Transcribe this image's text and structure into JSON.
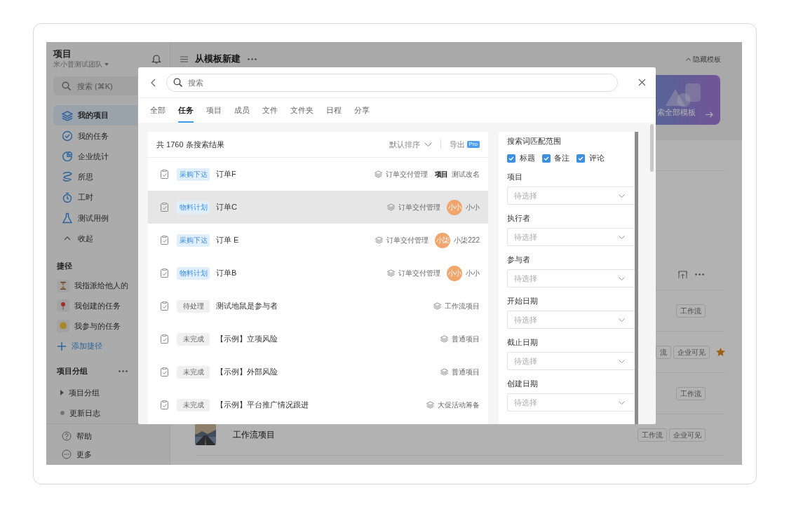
{
  "sidebar": {
    "title": "项目",
    "team": "米小普测试团队",
    "search_placeholder": "搜索 (⌘K)",
    "nav": [
      {
        "label": "我的项目",
        "selected": true
      },
      {
        "label": "我的任务",
        "selected": false
      },
      {
        "label": "企业统计",
        "selected": false
      },
      {
        "label": "所思",
        "selected": false
      },
      {
        "label": "工时",
        "selected": false
      },
      {
        "label": "测试用例",
        "selected": false
      },
      {
        "label": "收起",
        "selected": false
      }
    ],
    "shortcuts_title": "捷径",
    "shortcuts": [
      {
        "label": "我指派给他人的"
      },
      {
        "label": "我创建的任务"
      },
      {
        "label": "我参与的任务"
      }
    ],
    "add_shortcut": "添加捷径",
    "groups_title": "项目分组",
    "groups": [
      {
        "label": "项目分组",
        "kind": "folder"
      },
      {
        "label": "更新日志",
        "kind": "dot"
      }
    ],
    "footer": [
      {
        "label": "帮助"
      },
      {
        "label": "更多"
      }
    ]
  },
  "main": {
    "title": "从模板新建",
    "hide_templates": "隐藏模板",
    "banner": "索全部模板",
    "projects": [
      {
        "tags": [
          "工作流"
        ],
        "starred": false
      },
      {
        "tags": [
          "流",
          "企业可见"
        ],
        "starred": true
      },
      {
        "tags": [
          "工作流"
        ],
        "starred": false
      },
      {
        "name": "工作流项目",
        "thumbnail": {
          "kind": "picture"
        },
        "tags": [
          "工作流",
          "企业可见"
        ],
        "starred": false
      }
    ]
  },
  "modal": {
    "search_placeholder": "搜索",
    "tabs": [
      {
        "label": "全部",
        "selected": false
      },
      {
        "label": "任务",
        "selected": true
      },
      {
        "label": "项目",
        "selected": false
      },
      {
        "label": "成员",
        "selected": false
      },
      {
        "label": "文件",
        "selected": false
      },
      {
        "label": "文件夹",
        "selected": false
      },
      {
        "label": "日程",
        "selected": false
      },
      {
        "label": "分享",
        "selected": false
      }
    ],
    "results": {
      "summary": "共 1760 条搜索结果",
      "sort": "默认排序",
      "export": "导出",
      "export_badge": "Pro",
      "rows": [
        {
          "tag": {
            "text": "采购下达",
            "color": "#e1effd"
          },
          "title": "订单F",
          "project": "订单交付管理",
          "assignee": {
            "kind": "logo",
            "badge": "项目",
            "name": "测试改名"
          },
          "selected": false
        },
        {
          "tag": {
            "text": "物料计划",
            "color": "#e1effd"
          },
          "title": "订单C",
          "project": "订单交付管理",
          "assignee": {
            "kind": "avatar",
            "badge": "小小",
            "name": "小小"
          },
          "selected": true
        },
        {
          "tag": {
            "text": "采购下达",
            "color": "#e1effd"
          },
          "title": "订单 E",
          "project": "订单交付管理",
          "assignee": {
            "kind": "avatar",
            "badge": "小柒",
            "name": "小柒222"
          },
          "selected": false
        },
        {
          "tag": {
            "text": "物料计划",
            "color": "#e1effd"
          },
          "title": "订单B",
          "project": "订单交付管理",
          "assignee": {
            "kind": "avatar",
            "badge": "小小",
            "name": "小小"
          },
          "selected": false
        },
        {
          "tag": {
            "text": "待处理",
            "color": "#f0f0f0"
          },
          "title": "测试地鼠是参与者",
          "project": "工作流项目",
          "selected": false
        },
        {
          "tag": {
            "text": "未完成",
            "color": "#f0f0f0"
          },
          "title": "【示例】立项风险",
          "project": "普通项目",
          "selected": false
        },
        {
          "tag": {
            "text": "未完成",
            "color": "#f0f0f0"
          },
          "title": "【示例】外部风险",
          "project": "普通项目",
          "selected": false
        },
        {
          "tag": {
            "text": "未完成",
            "color": "#f0f0f0"
          },
          "title": "【示例】平台推广情况跟进",
          "project": "大促活动筹备",
          "selected": false
        }
      ]
    },
    "filters": {
      "match_title": "搜索词匹配范围",
      "match_options": [
        {
          "label": "标题",
          "checked": true
        },
        {
          "label": "备注",
          "checked": true
        },
        {
          "label": "评论",
          "checked": true
        }
      ],
      "fields": [
        {
          "label": "项目",
          "placeholder": "待选择"
        },
        {
          "label": "执行者",
          "placeholder": "待选择"
        },
        {
          "label": "参与者",
          "placeholder": "待选择"
        },
        {
          "label": "开始日期",
          "placeholder": "待选择"
        },
        {
          "label": "截止日期",
          "placeholder": "待选择"
        },
        {
          "label": "创建日期",
          "placeholder": "待选择"
        }
      ]
    }
  }
}
